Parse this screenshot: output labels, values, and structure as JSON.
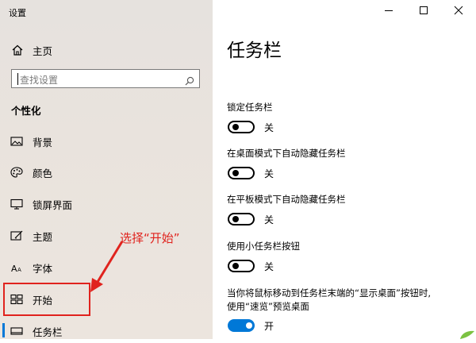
{
  "window": {
    "title": "设置"
  },
  "sidebar": {
    "home_label": "主页",
    "search_placeholder": "查找设置",
    "section_title": "个性化",
    "items": [
      {
        "label": "背景",
        "icon": "picture-icon"
      },
      {
        "label": "颜色",
        "icon": "palette-icon"
      },
      {
        "label": "锁屏界面",
        "icon": "lock-screen-icon"
      },
      {
        "label": "主题",
        "icon": "theme-brush-icon"
      },
      {
        "label": "字体",
        "icon": "font-icon"
      },
      {
        "label": "开始",
        "icon": "start-tiles-icon"
      },
      {
        "label": "任务栏",
        "icon": "taskbar-icon",
        "selected": true
      }
    ]
  },
  "annotation": {
    "text": "选择“开始”",
    "color": "#e0231e"
  },
  "main": {
    "title": "任务栏",
    "settings": [
      {
        "label": "锁定任务栏",
        "state": "关",
        "on": false
      },
      {
        "label": "在桌面模式下自动隐藏任务栏",
        "state": "关",
        "on": false
      },
      {
        "label": "在平板模式下自动隐藏任务栏",
        "state": "关",
        "on": false
      },
      {
        "label": "使用小任务栏按钮",
        "state": "关",
        "on": false
      },
      {
        "label_line1": "当你将鼠标移动到任务栏末端的“显示桌面”按钮时,",
        "label_line2": "使用“速览”预览桌面",
        "state": "开",
        "on": true
      }
    ]
  },
  "colors": {
    "accent": "#0078d7",
    "annotation": "#e0231e"
  }
}
